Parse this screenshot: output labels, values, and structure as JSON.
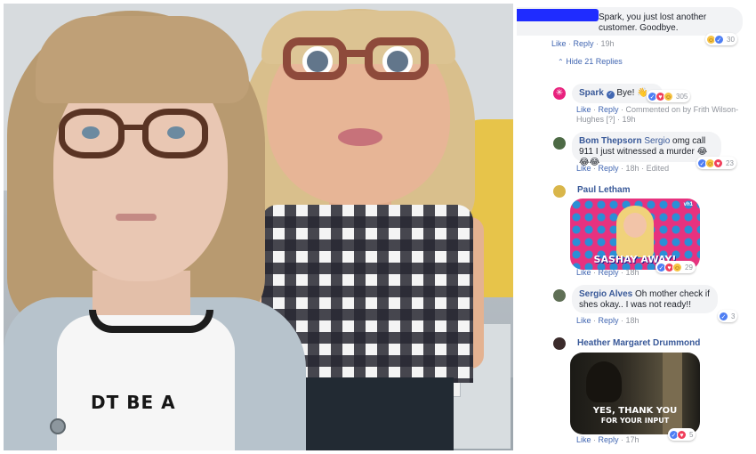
{
  "post_photo": {
    "shirt_text": "DT BE A"
  },
  "comments": {
    "root": {
      "text": "Spark, you just lost another customer. Goodbye.",
      "like": "Like",
      "reply": "Reply",
      "time": "19h",
      "reaction_count": "30",
      "hide_replies": "Hide 21 Replies"
    },
    "replies": [
      {
        "name": "Spark",
        "text": "Bye! 👋",
        "reaction_count": "305",
        "like": "Like",
        "reply": "Reply",
        "note": "Commented on by Frith Wilson-Hughes [?]",
        "time": "19h"
      },
      {
        "name": "Bom Thepsorn",
        "tag": "Sergio",
        "text": "omg call 911 I just witnessed a murder 😂😂😂",
        "reaction_count": "23",
        "like": "Like",
        "reply": "Reply",
        "time": "18h",
        "edited": "Edited"
      },
      {
        "name": "Paul Letham",
        "gif_caption": "SASHAY AWAY!",
        "gif_logo": "vh1",
        "reaction_count": "29",
        "like": "Like",
        "reply": "Reply",
        "time": "18h"
      },
      {
        "name": "Sergio Alves",
        "text": "Oh mother check if shes okay.. I was not ready!!",
        "reaction_count": "3",
        "like": "Like",
        "reply": "Reply",
        "time": "18h"
      },
      {
        "name": "Heather Margaret Drummond",
        "gif_caption_1": "YES, THANK YOU",
        "gif_caption_2": "FOR YOUR INPUT",
        "reaction_count": "5",
        "like": "Like",
        "reply": "Reply",
        "time": "17h"
      }
    ]
  },
  "colors": {
    "link_blue": "#385898",
    "redaction_blue": "#1f2cff",
    "bubble_gray": "#f2f3f5",
    "spark_pink": "#e8217d"
  }
}
